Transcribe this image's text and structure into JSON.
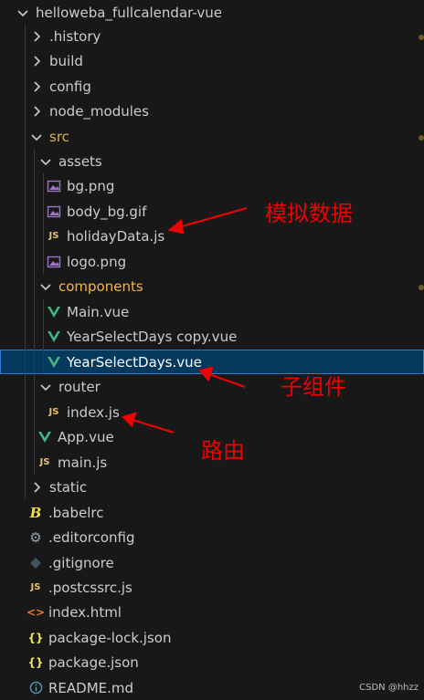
{
  "explorer": {
    "root": "helloweba_fullcalendar-vue",
    "items": [
      {
        "label": ".history"
      },
      {
        "label": "build"
      },
      {
        "label": "config"
      },
      {
        "label": "node_modules"
      },
      {
        "label": "src"
      },
      {
        "label": "assets"
      },
      {
        "label": "bg.png"
      },
      {
        "label": "body_bg.gif"
      },
      {
        "label": "holidayData.js"
      },
      {
        "label": "logo.png"
      },
      {
        "label": "components"
      },
      {
        "label": "Main.vue"
      },
      {
        "label": "YearSelectDays copy.vue"
      },
      {
        "label": "YearSelectDays.vue"
      },
      {
        "label": "router"
      },
      {
        "label": "index.js"
      },
      {
        "label": "App.vue"
      },
      {
        "label": "main.js"
      },
      {
        "label": "static"
      },
      {
        "label": ".babelrc"
      },
      {
        "label": ".editorconfig"
      },
      {
        "label": ".gitignore"
      },
      {
        "label": ".postcssrc.js"
      },
      {
        "label": "index.html"
      },
      {
        "label": "package-lock.json"
      },
      {
        "label": "package.json"
      },
      {
        "label": "README.md"
      }
    ]
  },
  "annotations": {
    "mock_data": "模拟数据",
    "child_component": "子组件",
    "route": "路由"
  },
  "watermark": "CSDN @hhzz",
  "colors": {
    "background": "#181818",
    "selection": "#04395e",
    "annotation": "#f00000",
    "vue": "#41b883",
    "js": "#e5c07b"
  },
  "icons": {
    "chevron": "chevron-icon",
    "image": "image-icon",
    "js": "js-icon",
    "vue": "vue-icon",
    "babel": "babel-icon",
    "gear": "gear-icon",
    "git": "git-icon",
    "html": "html-icon",
    "json": "json-icon",
    "info": "info-icon"
  }
}
